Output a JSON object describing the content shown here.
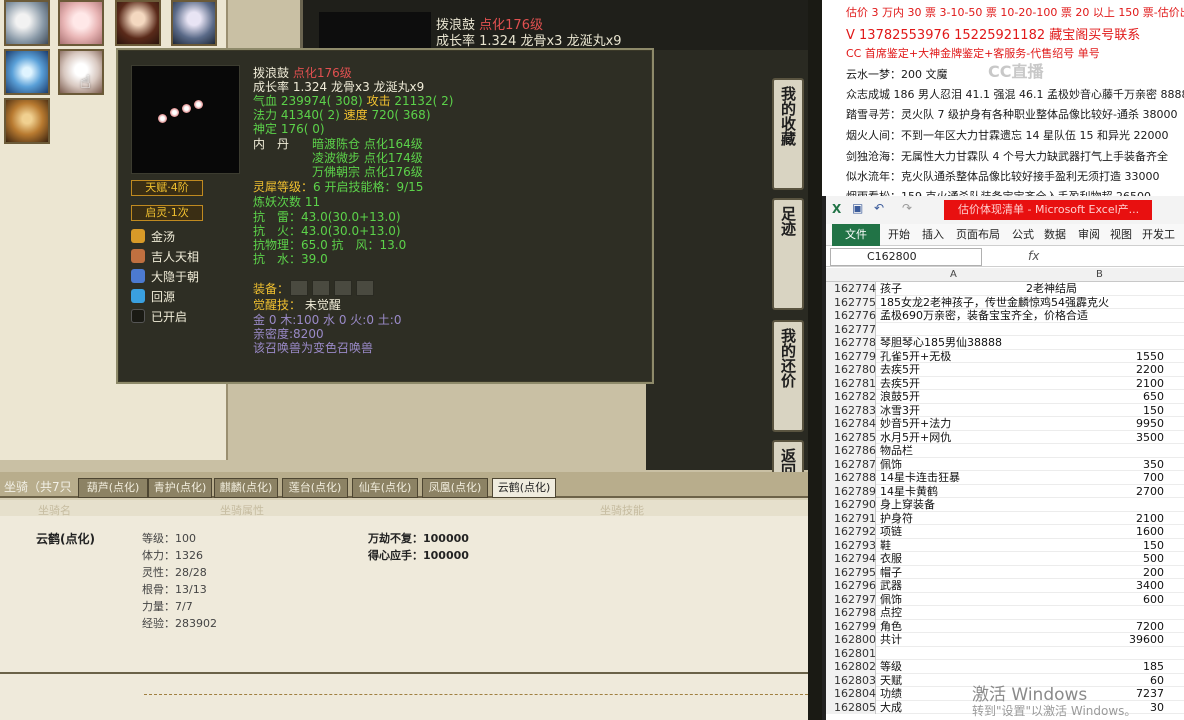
{
  "game": {
    "top_name": "拨浪鼓",
    "top_grade": "点化176级",
    "top_growth": "成长率 1.324 龙骨x3 龙涎丸x9",
    "tooltip": {
      "name": "拨浪鼓",
      "grade": "点化176级",
      "growth": "成长率 1.324 龙骨x3 龙涎丸x9",
      "hp_label": "气血",
      "hp_val": "239974( 308)",
      "atk_label": "攻击",
      "atk_val": "21132( 2)",
      "mp_label": "法力",
      "mp_val": "41340( 2)",
      "spd_label": "速度",
      "spd_val": "720( 368)",
      "shen": "神定 176( 0)",
      "neidan_label": "内　丹",
      "neidan": [
        "暗渡陈仓 点化164级",
        "凌波微步 点化174级",
        "万佛朝宗 点化176级"
      ],
      "lingxi_label": "灵犀等级：",
      "lingxi_val": "6 开启技能格：9/15",
      "lianyao": "炼妖次数 11",
      "kang1": "抗　雷：43.0(30.0+13.0)",
      "kang2": "抗　火：43.0(30.0+13.0)",
      "kang3": "抗物理：65.0 抗　风：13.0",
      "kang4": "抗　水：39.0",
      "equip_label": "装备：",
      "juexing_label": "觉醒技：",
      "juexing_val": "未觉醒",
      "wuxing": "金 0 木:100 水 0 火:0 土:0",
      "qinmi": "亲密度:8200",
      "note": "该召唤兽为变色召唤兽",
      "badge1": "天赋·4阶",
      "badge2": "启灵·1次",
      "skills": [
        "金汤",
        "吉人天相",
        "大隐于朝",
        "回源",
        "已开启"
      ]
    },
    "side_buttons": [
      "我的收藏",
      "足迹",
      "我的还价",
      "返回顶部"
    ],
    "mount": {
      "title": "坐骑（共7只",
      "tabs": [
        "葫芦(点化)",
        "青护(点化)",
        "麒麟(点化)",
        "莲台(点化)",
        "仙车(点化)",
        "凤凰(点化)",
        "云鹤(点化)"
      ],
      "head_name": "坐骑名",
      "head_attr": "坐骑属性",
      "head_skill": "坐骑技能",
      "name": "云鹤(点化)",
      "stats": [
        "等级：100",
        "体力：1326",
        "灵性：28/28",
        "根骨：13/13",
        "力量：7/7",
        "经验：283902"
      ],
      "skills": [
        "万劫不复：100000",
        "得心应手：100000"
      ]
    }
  },
  "notes": {
    "lines": [
      "估价 3 万内 30 票  3-10-50 票  10-20-100 票 20 以上 150 票-估价出现",
      "V 13782553976    15225921182   藏宝阁买号联系",
      "CC 首席鉴定+大神金牌鉴定+客服务-代售绍号 单号",
      "云水一梦：200 文魔",
      "众志成城 186 男人忍泪 41.1 强混 46.1 孟极妙音心藤千万亲密 8888",
      "踏雪寻芳：灵火队 7 级护身有各种职业整体品像比较好-通杀 38000",
      "烟火人间：不到一年区大力甘霖遗忘 14 星队伍 15 和异光 22000",
      "剑独沧海：无属性大力甘霖队 4 个号大力缺武器打气上手装备齐全",
      "似水流年：克火队通杀整体品像比较好接手盈利无须打造 33000",
      "烟雨看松：159 克火通杀队装备宝宝齐全入手盈利物超 26500"
    ],
    "watermark": "CC直播"
  },
  "excel": {
    "title": "估价体现清单 - Microsoft Excel产...",
    "tabs": [
      "文件",
      "开始",
      "插入",
      "页面布局",
      "公式",
      "数据",
      "审阅",
      "视图",
      "开发工具"
    ],
    "namebox": "C162800",
    "fx": "fx",
    "col_a": "A",
    "col_b": "B",
    "rows": [
      {
        "n": "162774",
        "a": "孩子",
        "b": "2老神结局",
        "v": ""
      },
      {
        "n": "162775",
        "a": "185女龙2老神孩子，传世金麟惊鸡54强霹克火",
        "b": "",
        "v": ""
      },
      {
        "n": "162776",
        "a": "孟极690万亲密，装备宝宝齐全，价格合适",
        "b": "",
        "v": ""
      },
      {
        "n": "162777",
        "a": "",
        "b": "",
        "v": ""
      },
      {
        "n": "162778",
        "a": "琴胆琴心185男仙38888",
        "b": "",
        "v": ""
      },
      {
        "n": "162779",
        "a": "孔雀5开+无极",
        "b": "",
        "v": "1550"
      },
      {
        "n": "162780",
        "a": "去疾5开",
        "b": "",
        "v": "2200"
      },
      {
        "n": "162781",
        "a": "去疾5开",
        "b": "",
        "v": "2100"
      },
      {
        "n": "162782",
        "a": "浪鼓5开",
        "b": "",
        "v": "650"
      },
      {
        "n": "162783",
        "a": "冰雪3开",
        "b": "",
        "v": "150"
      },
      {
        "n": "162784",
        "a": "妙音5开+法力",
        "b": "",
        "v": "9950"
      },
      {
        "n": "162785",
        "a": "水月5开+网仇",
        "b": "",
        "v": "3500"
      },
      {
        "n": "162786",
        "a": "物品栏",
        "b": "",
        "v": ""
      },
      {
        "n": "162787",
        "a": "佩饰",
        "b": "",
        "v": "350"
      },
      {
        "n": "162788",
        "a": "14星卡连击狂暴",
        "b": "",
        "v": "700"
      },
      {
        "n": "162789",
        "a": "14星卡黄鹤",
        "b": "",
        "v": "2700"
      },
      {
        "n": "162790",
        "a": "身上穿装备",
        "b": "",
        "v": ""
      },
      {
        "n": "162791",
        "a": "护身符",
        "b": "",
        "v": "2100"
      },
      {
        "n": "162792",
        "a": "项链",
        "b": "",
        "v": "1600"
      },
      {
        "n": "162793",
        "a": "鞋",
        "b": "",
        "v": "150"
      },
      {
        "n": "162794",
        "a": "衣服",
        "b": "",
        "v": "500"
      },
      {
        "n": "162795",
        "a": "帽子",
        "b": "",
        "v": "200"
      },
      {
        "n": "162796",
        "a": "武器",
        "b": "",
        "v": "3400"
      },
      {
        "n": "162797",
        "a": "佩饰",
        "b": "",
        "v": "600"
      },
      {
        "n": "162798",
        "a": "点控",
        "b": "",
        "v": ""
      },
      {
        "n": "162799",
        "a": "角色",
        "b": "",
        "v": "7200"
      },
      {
        "n": "162800",
        "a": "共计",
        "b": "",
        "v": "39600"
      },
      {
        "n": "162801",
        "a": "",
        "b": "",
        "v": ""
      },
      {
        "n": "162802",
        "a": "等级",
        "b": "",
        "v": "185"
      },
      {
        "n": "162803",
        "a": "天赋",
        "b": "",
        "v": "60"
      },
      {
        "n": "162804",
        "a": "功绩",
        "b": "",
        "v": "7237"
      },
      {
        "n": "162805",
        "a": "大成",
        "b": "",
        "v": "30"
      }
    ],
    "win_activate": "激活 Windows",
    "win_activate_sub": "转到\"设置\"以激活 Windows。"
  },
  "colors": {
    "excel_title_red": "#e81010",
    "excel_green": "#217346",
    "gold": "#f0c030",
    "pet_green": "#5cd24a"
  }
}
